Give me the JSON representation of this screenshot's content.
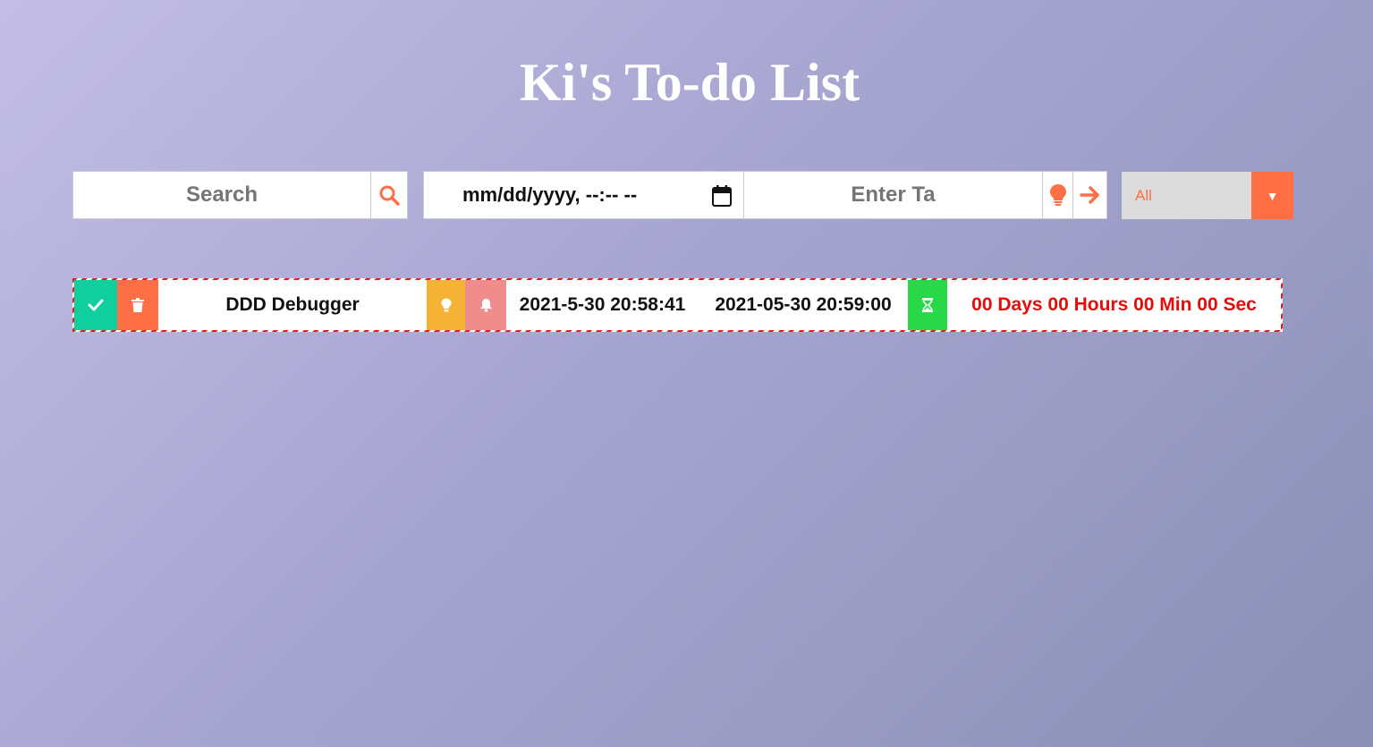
{
  "page": {
    "title": "Ki's To-do List"
  },
  "search": {
    "placeholder": "Search"
  },
  "date_input": {
    "placeholder": "mm/dd/yyyy, --:-- --"
  },
  "task_input": {
    "placeholder": "Enter Ta"
  },
  "filter": {
    "selected": "All",
    "arrow": "▼"
  },
  "todos": [
    {
      "text": "DDD Debugger",
      "created": "2021-5-30 20:58:41",
      "due": "2021-05-30 20:59:00",
      "countdown": "00 Days 00 Hours 00 Min 00 Sec"
    }
  ],
  "icons": {
    "search": "search-icon",
    "calendar": "calendar-icon",
    "idea": "lightbulb-icon",
    "add": "arrow-right-icon",
    "complete": "check-icon",
    "delete": "trash-icon",
    "priority": "lightbulb-icon",
    "reminder": "bell-icon",
    "timer": "hourglass-icon"
  },
  "colors": {
    "accent": "#ff6f45",
    "complete": "#0fcf9f",
    "priority": "#f5b335",
    "reminder": "#f08c8c",
    "timer": "#29d849",
    "overdue": "#e60c0c"
  }
}
